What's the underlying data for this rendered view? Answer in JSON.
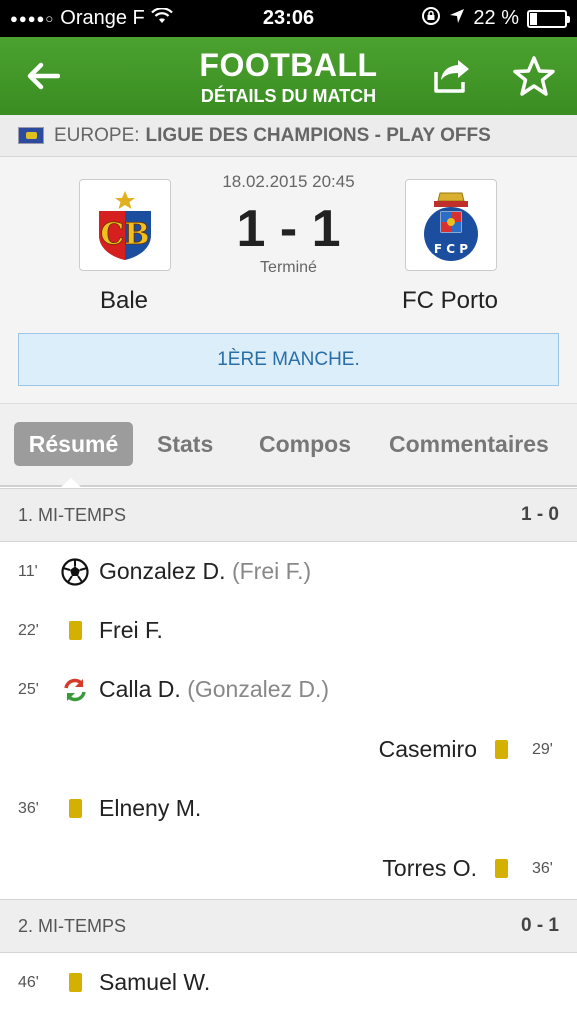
{
  "status_bar": {
    "signal": "●●●●○",
    "carrier": "Orange F",
    "time": "23:06",
    "battery_text": "22 %",
    "battery_level": 0.22
  },
  "header": {
    "title": "FOOTBALL",
    "subtitle": "DÉTAILS DU MATCH"
  },
  "competition": {
    "region": "EUROPE:",
    "name": "LIGUE DES CHAMPIONS - PLAY OFFS"
  },
  "match": {
    "date": "18.02.2015 20:45",
    "score": "1 - 1",
    "status": "Terminé",
    "home_team": "Bale",
    "away_team": "FC Porto",
    "round": "1ÈRE MANCHE."
  },
  "tabs": [
    "Résumé",
    "Stats",
    "Compos",
    "Commentaires"
  ],
  "periods": [
    {
      "label": "1. MI-TEMPS",
      "score": "1 - 0"
    },
    {
      "label": "2. MI-TEMPS",
      "score": "0 - 1"
    }
  ],
  "events": [
    {
      "minute": "11'",
      "side": "home",
      "type": "goal",
      "player": "Gonzalez D.",
      "assist": "(Frei F.)"
    },
    {
      "minute": "22'",
      "side": "home",
      "type": "yellow-card",
      "player": "Frei F.",
      "assist": ""
    },
    {
      "minute": "25'",
      "side": "home",
      "type": "substitution",
      "player": "Calla D.",
      "assist": "(Gonzalez D.)"
    },
    {
      "minute": "29'",
      "side": "away",
      "type": "yellow-card",
      "player": "Casemiro",
      "assist": ""
    },
    {
      "minute": "36'",
      "side": "home",
      "type": "yellow-card",
      "player": "Elneny M.",
      "assist": ""
    },
    {
      "minute": "36'",
      "side": "away",
      "type": "yellow-card",
      "player": "Torres O.",
      "assist": ""
    },
    {
      "minute": "46'",
      "side": "home",
      "type": "yellow-card",
      "player": "Samuel W.",
      "assist": ""
    }
  ],
  "colors": {
    "header_green": "#3f9526",
    "yellow_card": "#d4b000",
    "round_bg": "#dbeefa",
    "round_text": "#2a6ea8"
  }
}
